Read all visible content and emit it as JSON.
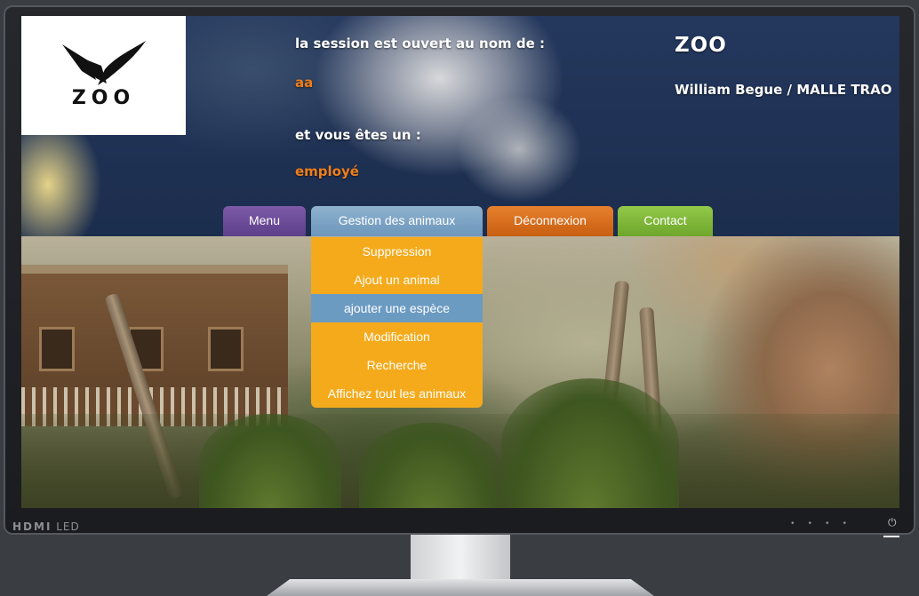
{
  "logo": {
    "text": "ZOO"
  },
  "header": {
    "session_label": "la session est ouvert au nom de :",
    "username": "aa",
    "role_label": "et vous êtes un :",
    "role": "employé",
    "site_title": "ZOO",
    "authors": "William Begue / MALLE TRAO"
  },
  "nav": {
    "menu": "Menu",
    "gestion": "Gestion des animaux",
    "deconnexion": "Déconnexion",
    "contact": "Contact"
  },
  "dropdown": {
    "items": [
      {
        "label": "Suppression"
      },
      {
        "label": "Ajout un animal"
      },
      {
        "label": "ajouter une espèce"
      },
      {
        "label": "Modification"
      },
      {
        "label": "Recherche"
      },
      {
        "label": "Affichez tout les animaux"
      }
    ],
    "highlighted": "ajouter une espèce"
  },
  "monitor": {
    "brand": "HDMI",
    "type": "LED"
  },
  "colors": {
    "menu_tab": "#6a4b98",
    "gestion_tab": "#7aa3c6",
    "deconnexion_tab": "#d96c1b",
    "contact_tab": "#7db838",
    "dropdown_bg": "#f4aa1b",
    "dropdown_active": "#6c9bc2",
    "accent_orange": "#f07e1b"
  }
}
